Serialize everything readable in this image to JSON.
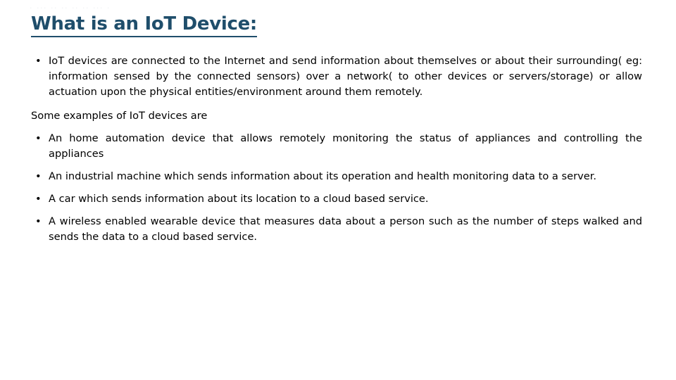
{
  "slide": {
    "title": "What is an IoT Device:",
    "title_color": "#1F4E6B",
    "background_color": "#FFFFFF",
    "body_text_color": "#000000",
    "top_artifact": "· ··· ·· ·· ·· ·· ··· ·",
    "bullet_glyph": "•"
  },
  "content": {
    "intro_bullet": "IoT devices are connected to the Internet and send information about themselves or about their surrounding( eg: information sensed by the connected sensors) over a network( to other devices or servers/storage) or allow actuation upon the physical entities/environment around them remotely.",
    "examples_lead": "Some examples of IoT devices are",
    "examples": [
      "An home automation device that allows remotely monitoring the status of appliances and controlling the appliances",
      "An industrial machine which sends information about its operation and health monitoring data to a server.",
      "A car which sends information about its location to a cloud based service.",
      "A wireless enabled wearable device that measures data about a person such as the number of steps walked and sends the data to a cloud based service."
    ]
  }
}
